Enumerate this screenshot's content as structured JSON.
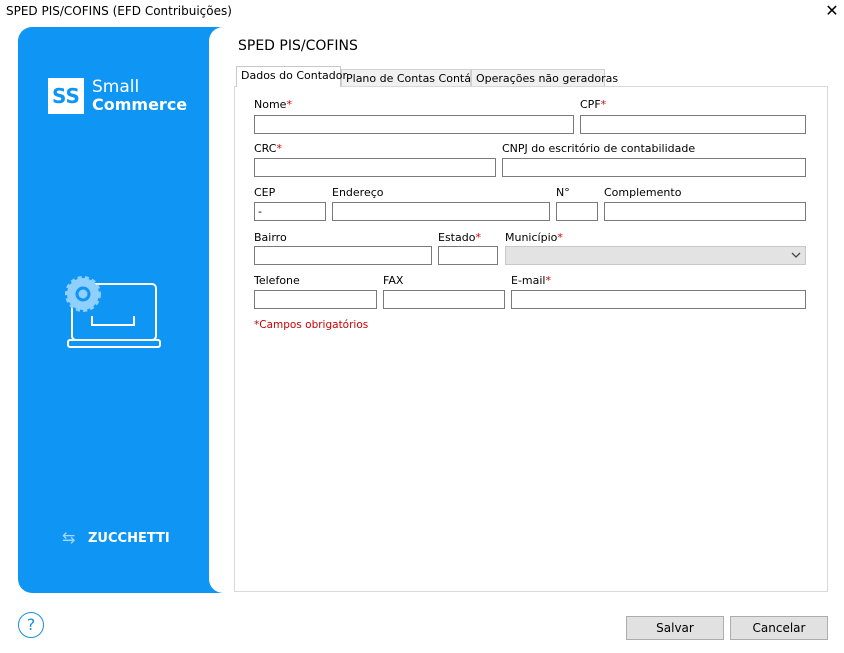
{
  "window": {
    "title": "SPED PIS/COFINS (EFD Contribuições)",
    "close": "✕"
  },
  "sidebar": {
    "logo_mark": "SS",
    "brand_line1": "Small",
    "brand_line2": "Commerce",
    "footer": "ZUCCHETTI"
  },
  "page": {
    "title": "SPED PIS/COFINS"
  },
  "tabs": [
    "Dados do Contador",
    "Plano de Contas Contábil",
    "Operações não geradoras"
  ],
  "form": {
    "nome": {
      "label": "Nome",
      "value": ""
    },
    "cpf": {
      "label": "CPF",
      "value": ""
    },
    "crc": {
      "label": "CRC",
      "value": ""
    },
    "cnpj": {
      "label": "CNPJ do escritório de contabilidade",
      "value": ""
    },
    "cep": {
      "label": "CEP",
      "value": "-"
    },
    "endereco": {
      "label": "Endereço",
      "value": ""
    },
    "numero": {
      "label": "N°",
      "value": ""
    },
    "complemento": {
      "label": "Complemento",
      "value": ""
    },
    "bairro": {
      "label": "Bairro",
      "value": ""
    },
    "estado": {
      "label": "Estado",
      "value": ""
    },
    "municipio": {
      "label": "Município",
      "value": ""
    },
    "telefone": {
      "label": "Telefone",
      "value": ""
    },
    "fax": {
      "label": "FAX",
      "value": ""
    },
    "email": {
      "label": "E-mail",
      "value": ""
    },
    "required_mark": "*",
    "note": "*Campos obrigatórios"
  },
  "buttons": {
    "save": "Salvar",
    "cancel": "Cancelar",
    "help": "?"
  },
  "colors": {
    "brand": "#0f96f5",
    "required": "#dd0000"
  }
}
